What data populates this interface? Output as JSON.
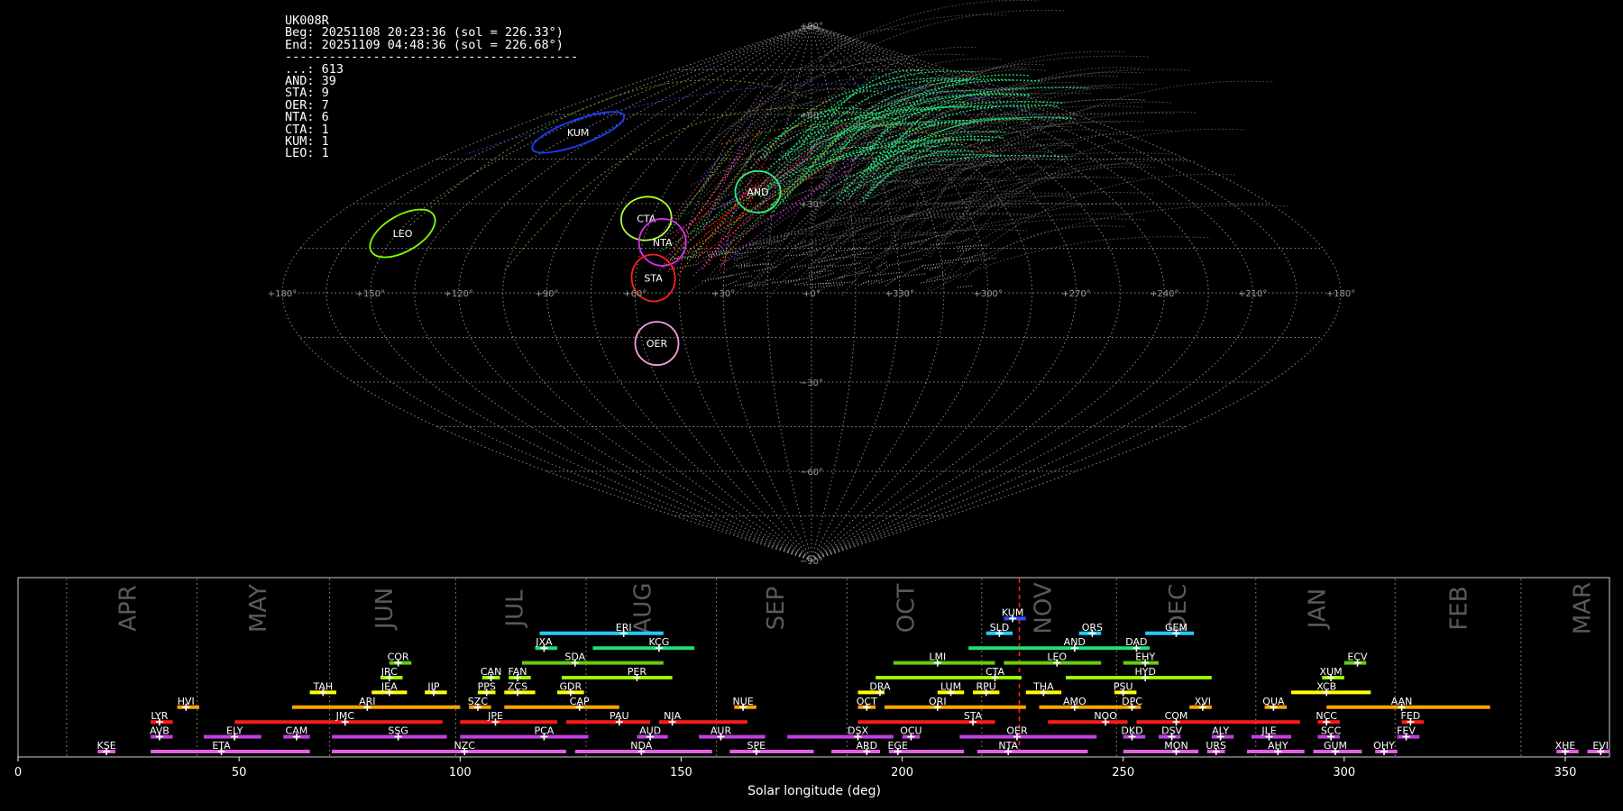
{
  "info": {
    "station": "UK008R",
    "beg": "Beg: 20251108 20:23:36 (sol = 226.33°)",
    "end": "End: 20251109 04:48:36 (sol = 226.68°)",
    "rule": "----------------------------------------",
    "counts": [
      {
        "code": "...",
        "n": 613
      },
      {
        "code": "AND",
        "n": 39
      },
      {
        "code": "STA",
        "n": 9
      },
      {
        "code": "OER",
        "n": 7
      },
      {
        "code": "NTA",
        "n": 6
      },
      {
        "code": "CTA",
        "n": 1
      },
      {
        "code": "KUM",
        "n": 1
      },
      {
        "code": "LEO",
        "n": 1
      }
    ]
  },
  "chart_data": [
    {
      "type": "scatter",
      "title": "",
      "projection": "sinusoidal sky map",
      "x_tick_labels": [
        "+180°",
        "+150°",
        "+120°",
        "+90°",
        "+60°",
        "+30°",
        "+0°",
        "+330°",
        "+300°",
        "+270°",
        "+240°",
        "+210°",
        "+180°"
      ],
      "y_tick_labels": [
        "+90°",
        "+60°",
        "+30°",
        "−30°",
        "−60°",
        "−90°"
      ],
      "radiants": [
        {
          "name": "KUM",
          "lon": 135,
          "lat": 54,
          "color": "#1e3cff"
        },
        {
          "name": "LEO",
          "lon": 148,
          "lat": 20,
          "color": "#7fff00"
        },
        {
          "name": "CTA",
          "lon": 62,
          "lat": 25,
          "color": "#adff2f"
        },
        {
          "name": "NTA",
          "lon": 53,
          "lat": 17,
          "color": "#da30f0"
        },
        {
          "name": "STA",
          "lon": 54,
          "lat": 5,
          "color": "#ff2020"
        },
        {
          "name": "AND",
          "lon": 22,
          "lat": 34,
          "color": "#2af07a"
        },
        {
          "name": "OER",
          "lon": 55,
          "lat": -17,
          "color": "#f0a0e0"
        }
      ]
    },
    {
      "type": "bar",
      "title": "",
      "xlabel": "Solar longitude (deg)",
      "xlim": [
        0,
        360
      ],
      "x_ticks": [
        0,
        50,
        100,
        150,
        200,
        250,
        300,
        350
      ],
      "current_sol": 226.5,
      "months": [
        {
          "label": "APR",
          "pos": 25,
          "boundary": 11
        },
        {
          "label": "MAY",
          "pos": 54.5,
          "boundary": 40.5
        },
        {
          "label": "JUN",
          "pos": 83,
          "boundary": 70.5
        },
        {
          "label": "JUL",
          "pos": 112.5,
          "boundary": 99
        },
        {
          "label": "AUG",
          "pos": 141.5,
          "boundary": 128.5
        },
        {
          "label": "SEP",
          "pos": 171.5,
          "boundary": 158
        },
        {
          "label": "OCT",
          "pos": 201,
          "boundary": 187.5
        },
        {
          "label": "NOV",
          "pos": 232,
          "boundary": 218
        },
        {
          "label": "DEC",
          "pos": 262.5,
          "boundary": 248.5
        },
        {
          "label": "JAN",
          "pos": 294,
          "boundary": 280
        },
        {
          "label": "FEB",
          "pos": 326,
          "boundary": 311.5
        },
        {
          "label": "MAR",
          "pos": 354,
          "boundary": 340
        }
      ],
      "showers": [
        {
          "name": "KSE",
          "start": 18,
          "end": 22,
          "peak": 20,
          "row": 0,
          "color": "#e060e0"
        },
        {
          "name": "ETA",
          "start": 30,
          "end": 66,
          "peak": 46,
          "row": 0,
          "color": "#e060e0"
        },
        {
          "name": "NZC",
          "start": 71,
          "end": 124,
          "peak": 101,
          "row": 0,
          "color": "#e060e0"
        },
        {
          "name": "NDA",
          "start": 126,
          "end": 157,
          "peak": 141,
          "row": 0,
          "color": "#e060e0"
        },
        {
          "name": "SPE",
          "start": 161,
          "end": 180,
          "peak": 167,
          "row": 0,
          "color": "#e060e0"
        },
        {
          "name": "ARD",
          "start": 184,
          "end": 195,
          "peak": 192,
          "row": 0,
          "color": "#e060e0"
        },
        {
          "name": "EGE",
          "start": 197,
          "end": 214,
          "peak": 199,
          "row": 0,
          "color": "#e060e0"
        },
        {
          "name": "NTA",
          "start": 217,
          "end": 242,
          "peak": 224,
          "row": 0,
          "color": "#e060e0"
        },
        {
          "name": "MON",
          "start": 250,
          "end": 267,
          "peak": 262,
          "row": 0,
          "color": "#e060e0"
        },
        {
          "name": "URS",
          "start": 269,
          "end": 273,
          "peak": 271,
          "row": 0,
          "color": "#e060e0"
        },
        {
          "name": "AHY",
          "start": 278,
          "end": 291,
          "peak": 285,
          "row": 0,
          "color": "#e060e0"
        },
        {
          "name": "GUM",
          "start": 293,
          "end": 304,
          "peak": 298,
          "row": 0,
          "color": "#e060e0"
        },
        {
          "name": "OHY",
          "start": 307,
          "end": 312,
          "peak": 309,
          "row": 0,
          "color": "#e060e0"
        },
        {
          "name": "XHE",
          "start": 348,
          "end": 353,
          "peak": 350,
          "row": 0,
          "color": "#e060e0"
        },
        {
          "name": "EVI",
          "start": 355,
          "end": 360,
          "peak": 358,
          "row": 0,
          "color": "#e060e0"
        },
        {
          "name": "AVB",
          "start": 30,
          "end": 35,
          "peak": 32,
          "row": 1,
          "color": "#c040e0"
        },
        {
          "name": "ELY",
          "start": 42,
          "end": 55,
          "peak": 49,
          "row": 1,
          "color": "#c040e0"
        },
        {
          "name": "CAM",
          "start": 60,
          "end": 66,
          "peak": 63,
          "row": 1,
          "color": "#c040e0"
        },
        {
          "name": "SSG",
          "start": 71,
          "end": 97,
          "peak": 86,
          "row": 1,
          "color": "#c040e0"
        },
        {
          "name": "PCA",
          "start": 100,
          "end": 129,
          "peak": 119,
          "row": 1,
          "color": "#c040e0"
        },
        {
          "name": "AUD",
          "start": 140,
          "end": 147,
          "peak": 143,
          "row": 1,
          "color": "#c040e0"
        },
        {
          "name": "AUR",
          "start": 154,
          "end": 169,
          "peak": 159,
          "row": 1,
          "color": "#c040e0"
        },
        {
          "name": "DSX",
          "start": 174,
          "end": 198,
          "peak": 190,
          "row": 1,
          "color": "#c040e0"
        },
        {
          "name": "OCU",
          "start": 200,
          "end": 204,
          "peak": 202,
          "row": 1,
          "color": "#c040e0"
        },
        {
          "name": "OER",
          "start": 213,
          "end": 244,
          "peak": 226,
          "row": 1,
          "color": "#c040e0"
        },
        {
          "name": "DKD",
          "start": 250,
          "end": 255,
          "peak": 252,
          "row": 1,
          "color": "#c040e0"
        },
        {
          "name": "DSV",
          "start": 258,
          "end": 263,
          "peak": 261,
          "row": 1,
          "color": "#c040e0"
        },
        {
          "name": "ALY",
          "start": 270,
          "end": 275,
          "peak": 272,
          "row": 1,
          "color": "#c040e0"
        },
        {
          "name": "JLE",
          "start": 279,
          "end": 288,
          "peak": 283,
          "row": 1,
          "color": "#c040e0"
        },
        {
          "name": "SCC",
          "start": 294,
          "end": 299,
          "peak": 297,
          "row": 1,
          "color": "#c040e0"
        },
        {
          "name": "FEV",
          "start": 312,
          "end": 317,
          "peak": 314,
          "row": 1,
          "color": "#c040e0"
        },
        {
          "name": "LYR",
          "start": 30,
          "end": 35,
          "peak": 32,
          "row": 2,
          "color": "#ff1a1a"
        },
        {
          "name": "JMC",
          "start": 49,
          "end": 96,
          "peak": 74,
          "row": 2,
          "color": "#ff1a1a"
        },
        {
          "name": "JPE",
          "start": 100,
          "end": 122,
          "peak": 108,
          "row": 2,
          "color": "#ff1a1a"
        },
        {
          "name": "PAU",
          "start": 124,
          "end": 143,
          "peak": 136,
          "row": 2,
          "color": "#ff1a1a"
        },
        {
          "name": "NIA",
          "start": 145,
          "end": 165,
          "peak": 148,
          "row": 2,
          "color": "#ff1a1a"
        },
        {
          "name": "STA",
          "start": 190,
          "end": 221,
          "peak": 216,
          "row": 2,
          "color": "#ff1a1a"
        },
        {
          "name": "NOO",
          "start": 233,
          "end": 251,
          "peak": 246,
          "row": 2,
          "color": "#ff1a1a"
        },
        {
          "name": "COM",
          "start": 253,
          "end": 290,
          "peak": 262,
          "row": 2,
          "color": "#ff1a1a"
        },
        {
          "name": "NCC",
          "start": 294,
          "end": 299,
          "peak": 296,
          "row": 2,
          "color": "#ff1a1a"
        },
        {
          "name": "FED",
          "start": 313,
          "end": 318,
          "peak": 315,
          "row": 2,
          "color": "#ff1a1a"
        },
        {
          "name": "HVI",
          "start": 36,
          "end": 41,
          "peak": 38,
          "row": 3,
          "color": "#ffa500"
        },
        {
          "name": "ARI",
          "start": 62,
          "end": 100,
          "peak": 79,
          "row": 3,
          "color": "#ffa500"
        },
        {
          "name": "SZC",
          "start": 102,
          "end": 107,
          "peak": 104,
          "row": 3,
          "color": "#ffa500"
        },
        {
          "name": "CAP",
          "start": 110,
          "end": 136,
          "peak": 127,
          "row": 3,
          "color": "#ffa500"
        },
        {
          "name": "NUE",
          "start": 162,
          "end": 167,
          "peak": 164,
          "row": 3,
          "color": "#ffa500"
        },
        {
          "name": "OCT",
          "start": 190,
          "end": 194,
          "peak": 192,
          "row": 3,
          "color": "#ffa500"
        },
        {
          "name": "ORI",
          "start": 196,
          "end": 228,
          "peak": 208,
          "row": 3,
          "color": "#ffa500"
        },
        {
          "name": "AMO",
          "start": 231,
          "end": 250,
          "peak": 239,
          "row": 3,
          "color": "#ffa500"
        },
        {
          "name": "DPC",
          "start": 250,
          "end": 254,
          "peak": 252,
          "row": 3,
          "color": "#ffa500"
        },
        {
          "name": "XVI",
          "start": 265,
          "end": 270,
          "peak": 268,
          "row": 3,
          "color": "#ffa500"
        },
        {
          "name": "QUA",
          "start": 282,
          "end": 287,
          "peak": 284,
          "row": 3,
          "color": "#ffa500"
        },
        {
          "name": "AAN",
          "start": 296,
          "end": 333,
          "peak": 313,
          "row": 3,
          "color": "#ffa500"
        },
        {
          "name": "TAH",
          "start": 66,
          "end": 72,
          "peak": 69,
          "row": 4,
          "color": "#ffff00"
        },
        {
          "name": "JEA",
          "start": 80,
          "end": 88,
          "peak": 84,
          "row": 4,
          "color": "#ffff00"
        },
        {
          "name": "JIP",
          "start": 92,
          "end": 97,
          "peak": 94,
          "row": 4,
          "color": "#ffff00"
        },
        {
          "name": "PPS",
          "start": 104,
          "end": 108,
          "peak": 106,
          "row": 4,
          "color": "#ffff00"
        },
        {
          "name": "ZCS",
          "start": 110,
          "end": 117,
          "peak": 113,
          "row": 4,
          "color": "#ffff00"
        },
        {
          "name": "GDR",
          "start": 122,
          "end": 128,
          "peak": 125,
          "row": 4,
          "color": "#ffff00"
        },
        {
          "name": "DRA",
          "start": 190,
          "end": 196,
          "peak": 195,
          "row": 4,
          "color": "#ffff00"
        },
        {
          "name": "LUM",
          "start": 208,
          "end": 214,
          "peak": 211,
          "row": 4,
          "color": "#ffff00"
        },
        {
          "name": "RPU",
          "start": 216,
          "end": 222,
          "peak": 219,
          "row": 4,
          "color": "#ffff00"
        },
        {
          "name": "THA",
          "start": 228,
          "end": 236,
          "peak": 232,
          "row": 4,
          "color": "#ffff00"
        },
        {
          "name": "PSU",
          "start": 248,
          "end": 253,
          "peak": 250,
          "row": 4,
          "color": "#ffff00"
        },
        {
          "name": "XCB",
          "start": 288,
          "end": 306,
          "peak": 296,
          "row": 4,
          "color": "#ffff00"
        },
        {
          "name": "JRC",
          "start": 82,
          "end": 87,
          "peak": 84,
          "row": 5,
          "color": "#9aff00"
        },
        {
          "name": "CAN",
          "start": 105,
          "end": 109,
          "peak": 107,
          "row": 5,
          "color": "#9aff00"
        },
        {
          "name": "FAN",
          "start": 111,
          "end": 116,
          "peak": 113,
          "row": 5,
          "color": "#9aff00"
        },
        {
          "name": "PER",
          "start": 123,
          "end": 148,
          "peak": 140,
          "row": 5,
          "color": "#9aff00"
        },
        {
          "name": "CTA",
          "start": 194,
          "end": 227,
          "peak": 221,
          "row": 5,
          "color": "#9aff00"
        },
        {
          "name": "HYD",
          "start": 237,
          "end": 270,
          "peak": 255,
          "row": 5,
          "color": "#9aff00"
        },
        {
          "name": "XUM",
          "start": 295,
          "end": 300,
          "peak": 297,
          "row": 5,
          "color": "#9aff00"
        },
        {
          "name": "COR",
          "start": 84,
          "end": 89,
          "peak": 86,
          "row": 6,
          "color": "#66cc11"
        },
        {
          "name": "SDA",
          "start": 114,
          "end": 146,
          "peak": 126,
          "row": 6,
          "color": "#66cc11"
        },
        {
          "name": "LMI",
          "start": 198,
          "end": 221,
          "peak": 208,
          "row": 6,
          "color": "#66cc11"
        },
        {
          "name": "LEO",
          "start": 223,
          "end": 245,
          "peak": 235,
          "row": 6,
          "color": "#66cc11"
        },
        {
          "name": "EHY",
          "start": 250,
          "end": 258,
          "peak": 255,
          "row": 6,
          "color": "#66cc11"
        },
        {
          "name": "ECV",
          "start": 300,
          "end": 305,
          "peak": 303,
          "row": 6,
          "color": "#66cc11"
        },
        {
          "name": "JXA",
          "start": 117,
          "end": 122,
          "peak": 119,
          "row": 7,
          "color": "#22dd77"
        },
        {
          "name": "KCG",
          "start": 130,
          "end": 153,
          "peak": 145,
          "row": 7,
          "color": "#22dd77"
        },
        {
          "name": "AND",
          "start": 215,
          "end": 250,
          "peak": 239,
          "row": 7,
          "color": "#22dd77"
        },
        {
          "name": "DAD",
          "start": 250,
          "end": 256,
          "peak": 253,
          "row": 7,
          "color": "#22dd77"
        },
        {
          "name": "ERI",
          "start": 118,
          "end": 146,
          "peak": 137,
          "row": 8,
          "color": "#22ccff"
        },
        {
          "name": "SLD",
          "start": 219,
          "end": 225,
          "peak": 222,
          "row": 8,
          "color": "#22ccff"
        },
        {
          "name": "ORS",
          "start": 240,
          "end": 245,
          "peak": 243,
          "row": 8,
          "color": "#22ccff"
        },
        {
          "name": "GEM",
          "start": 255,
          "end": 266,
          "peak": 262,
          "row": 8,
          "color": "#22ccff"
        },
        {
          "name": "KUM",
          "start": 223,
          "end": 228,
          "peak": 225,
          "row": 9,
          "color": "#3050ff"
        }
      ]
    }
  ]
}
